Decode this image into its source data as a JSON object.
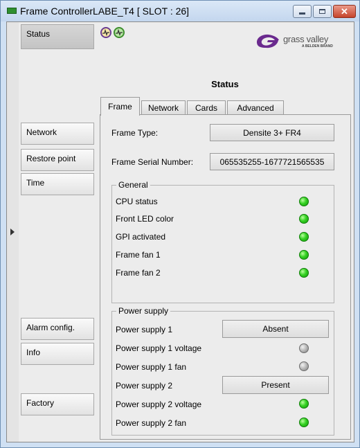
{
  "window": {
    "title": "Frame ControllerLABE_T4 [ SLOT : 26]",
    "close_glyph": "✕"
  },
  "nav": {
    "items": [
      "Status",
      "Network",
      "Restore point",
      "Time",
      "Alarm config.",
      "Info",
      "Factory"
    ],
    "selected": "Status"
  },
  "header": {
    "icons": [
      "status-icon-purple",
      "status-icon-green"
    ],
    "logo_text": "grass valley",
    "logo_subtext": "A BELDEN BRAND"
  },
  "page": {
    "heading": "Status",
    "tabs": [
      "Frame",
      "Network",
      "Cards",
      "Advanced"
    ],
    "selected_tab": "Frame"
  },
  "frame": {
    "type_label": "Frame Type:",
    "type_value": "Densite 3+ FR4",
    "serial_label": "Frame Serial Number:",
    "serial_value": "065535255-1677721565535"
  },
  "general": {
    "legend": "General",
    "items": [
      {
        "label": "CPU status",
        "led": "green"
      },
      {
        "label": "Front LED color",
        "led": "green"
      },
      {
        "label": "GPI activated",
        "led": "green"
      },
      {
        "label": "Frame fan 1",
        "led": "green"
      },
      {
        "label": "Frame fan 2",
        "led": "green"
      }
    ]
  },
  "power": {
    "legend": "Power supply",
    "ps1_label": "Power supply 1",
    "ps1_value": "Absent",
    "ps1_voltage_label": "Power supply 1 voltage",
    "ps1_voltage_led": "gray",
    "ps1_fan_label": "Power supply 1 fan",
    "ps1_fan_led": "gray",
    "ps2_label": "Power supply 2",
    "ps2_value": "Present",
    "ps2_voltage_label": "Power supply 2 voltage",
    "ps2_voltage_led": "green",
    "ps2_fan_label": "Power supply 2 fan",
    "ps2_fan_led": "green"
  },
  "colors": {
    "led_green": "#35d123",
    "led_gray": "#b6b6b6",
    "titlebar": "#c3d6ee",
    "close_button": "#c6432b"
  }
}
